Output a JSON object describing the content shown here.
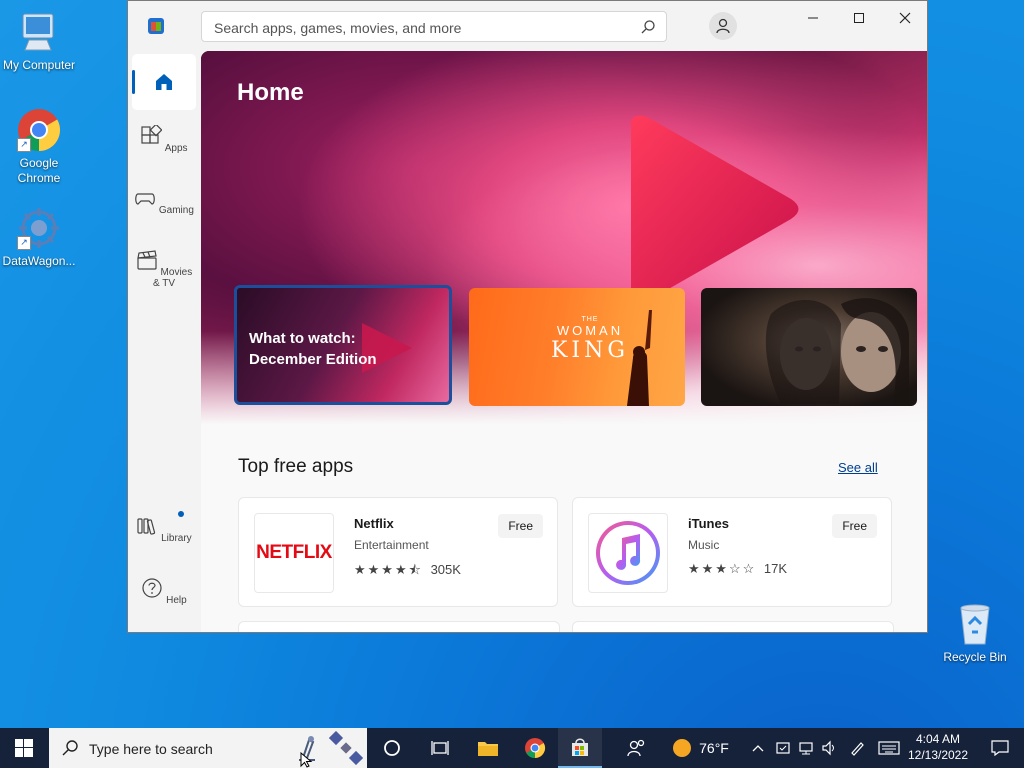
{
  "desktop": {
    "icons": [
      {
        "label": "My Computer"
      },
      {
        "label": "Google Chrome"
      },
      {
        "label": "DataWagon..."
      },
      {
        "label": "Recycle Bin"
      }
    ]
  },
  "store": {
    "search_placeholder": "Search apps, games, movies, and more",
    "nav": [
      {
        "label": "",
        "icon": "home-icon"
      },
      {
        "label": "Apps",
        "icon": "apps-icon"
      },
      {
        "label": "Gaming",
        "icon": "gamepad-icon"
      },
      {
        "label": "Movies & TV",
        "icon": "clapperboard-icon"
      },
      {
        "label": "Library",
        "icon": "library-icon"
      },
      {
        "label": "Help",
        "icon": "help-icon"
      }
    ],
    "hero": {
      "title": "Home",
      "cards": [
        {
          "text_line1": "What to watch:",
          "text_line2": "December Edition"
        },
        {
          "small": "THE",
          "line1": "WOMAN",
          "line2": "KING"
        },
        {
          "label": ""
        }
      ]
    },
    "section": {
      "title": "Top free apps",
      "see_all": "See all"
    },
    "apps": [
      {
        "name": "Netflix",
        "logo_text": "NETFLIX",
        "category": "Entertainment",
        "price": "Free",
        "stars": "★★★★⯪",
        "rating": 4.5,
        "count": "305K"
      },
      {
        "name": "iTunes",
        "category": "Music",
        "price": "Free",
        "stars": "★★★☆☆",
        "rating": 3,
        "count": "17K"
      }
    ]
  },
  "taskbar": {
    "search_placeholder": "Type here to search",
    "weather": "76°F",
    "time": "4:04 AM",
    "date": "12/13/2022"
  },
  "colors": {
    "accent": "#005fb8",
    "taskbar": "#16213a",
    "netflix_red": "#e50914"
  }
}
